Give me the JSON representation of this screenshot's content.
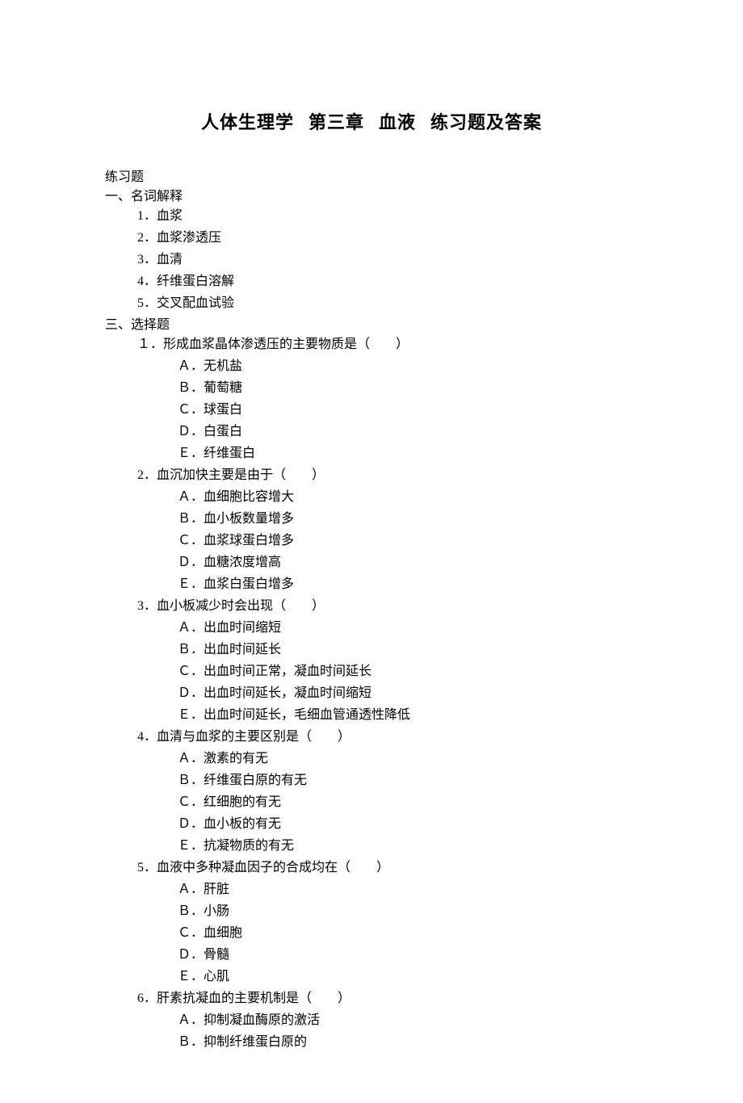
{
  "title_segments": [
    "人体生理学",
    "第三章",
    "血液",
    "练习题及答案"
  ],
  "exercise_label": "练习题",
  "section1_heading": "一、名词解释",
  "terms": [
    "1．血浆",
    "2．血浆渗透压",
    "3．血清",
    "4．纤维蛋白溶解",
    "5．交叉配血试验"
  ],
  "section3_heading": "三、选择题",
  "questions": [
    {
      "stem": "１．形成血浆晶体渗透压的主要物质是（　　）",
      "options": [
        "Ａ．无机盐",
        "Ｂ．葡萄糖",
        "Ｃ．球蛋白",
        "Ｄ．白蛋白",
        "Ｅ．纤维蛋白"
      ]
    },
    {
      "stem": "2．血沉加快主要是由于（　　）",
      "options": [
        "Ａ．血细胞比容增大",
        "Ｂ．血小板数量增多",
        "Ｃ．血浆球蛋白增多",
        "Ｄ．血糖浓度增高",
        "Ｅ．血浆白蛋白增多"
      ]
    },
    {
      "stem": "3．血小板减少时会出现（　　）",
      "options": [
        "Ａ．出血时间缩短",
        "Ｂ．出血时间延长",
        "Ｃ．出血时间正常，凝血时间延长",
        "Ｄ．出血时间延长，凝血时间缩短",
        "Ｅ．出血时间延长，毛细血管通透性降低"
      ]
    },
    {
      "stem": "4．血清与血浆的主要区别是（　　）",
      "options": [
        "Ａ．激素的有无",
        "Ｂ．纤维蛋白原的有无",
        "Ｃ．红细胞的有无",
        "Ｄ．血小板的有无",
        "Ｅ．抗凝物质的有无"
      ]
    },
    {
      "stem": "5．血液中多种凝血因子的合成均在（　　）",
      "options": [
        "Ａ．肝脏",
        "Ｂ．小肠",
        "Ｃ．血细胞",
        "Ｄ．骨髓",
        "Ｅ．心肌"
      ]
    },
    {
      "stem": "6．肝素抗凝血的主要机制是（　　）",
      "options": [
        "Ａ．抑制凝血酶原的激活",
        "Ｂ．抑制纤维蛋白原的"
      ]
    }
  ]
}
